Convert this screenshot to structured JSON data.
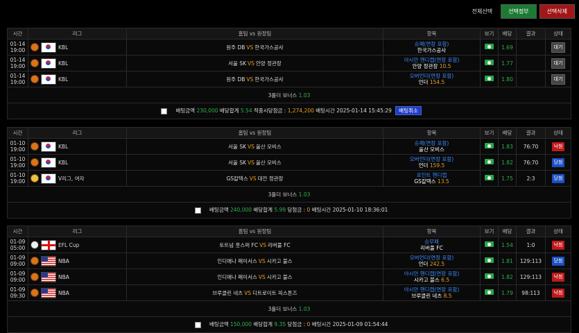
{
  "toolbar": {
    "select_all": "전체선택",
    "delete_selected_btn": "선택정부",
    "cancel_selected_btn": "선택삭제"
  },
  "headers": {
    "time": "시간",
    "league": "리그",
    "match": "홈팀 vs 원정팀",
    "item": "항목",
    "view": "보기",
    "odds": "배당",
    "result": "결과",
    "status": "상태"
  },
  "blocks": [
    {
      "rows": [
        {
          "date": "01-14",
          "time": "19:00",
          "icon": "basketball",
          "flag": "kr",
          "league": "KBL",
          "home": "원주 DB",
          "away": "한국가스공사",
          "item": "승패(연장 포함)",
          "pick": "한국가스공사",
          "pick_num": "",
          "odds": "1.69",
          "result": "",
          "status": "대기",
          "status_type": "wait"
        },
        {
          "date": "01-14",
          "time": "19:00",
          "icon": "basketball",
          "flag": "kr",
          "league": "KBL",
          "home": "서울 SK",
          "away": "안양 정관장",
          "item": "아시안 핸디캡(연장 포함)",
          "pick": "안양 정관장",
          "pick_num": "10.5",
          "odds": "1.77",
          "result": "",
          "status": "대기",
          "status_type": "wait"
        },
        {
          "date": "01-14",
          "time": "19:00",
          "icon": "basketball",
          "flag": "kr",
          "league": "KBL",
          "home": "원주 DB",
          "away": "한국가스공사",
          "item": "오버언더(연장 포함)",
          "pick": "언더",
          "pick_num": "154.5",
          "odds": "1.80",
          "result": "",
          "status": "대기",
          "status_type": "wait"
        }
      ],
      "bonus_label": "3폴더 보너스",
      "bonus_value": "1.03",
      "summary": {
        "amount_label": "배팅금액",
        "amount": "230,000",
        "total_label": "배당합계",
        "total": "5.54",
        "win_label": "적중시당첨금 :",
        "win": "1,274,200",
        "time_label": "배팅시간",
        "time": "2025-01-14 15:45:29",
        "cancel": "배팅취소"
      }
    },
    {
      "rows": [
        {
          "date": "01-10",
          "time": "19:00",
          "icon": "basketball",
          "flag": "kr",
          "league": "KBL",
          "home": "서울 SK",
          "away": "울산 모비스",
          "item": "승패(연장 포함)",
          "pick": "울산 모비스",
          "pick_num": "",
          "odds": "1.83",
          "result": "76:70",
          "status": "낙첨",
          "status_type": "lose"
        },
        {
          "date": "01-10",
          "time": "19:00",
          "icon": "basketball",
          "flag": "kr",
          "league": "KBL",
          "home": "서울 SK",
          "away": "울산 모비스",
          "item": "오버언더(연장 포함)",
          "pick": "언더",
          "pick_num": "159.5",
          "odds": "1.82",
          "result": "76:70",
          "status": "당첨",
          "status_type": "win"
        },
        {
          "date": "01-10",
          "time": "19:00",
          "icon": "volleyball",
          "flag": "kr",
          "league": "V리그, 여자",
          "home": "GS칼텍스",
          "away": "대전 정관장",
          "item": "포인트 핸디캡",
          "pick": "GS칼텍스",
          "pick_num": "13.5",
          "odds": "1.75",
          "result": "2:3",
          "status": "당첨",
          "status_type": "win"
        }
      ],
      "bonus_label": "3폴더 보너스",
      "bonus_value": "1.03",
      "summary": {
        "amount_label": "배팅금액",
        "amount": "240,000",
        "total_label": "배당합계",
        "total": "5.99",
        "win_label": "당첨금 :",
        "win": "0",
        "time_label": "배팅시간",
        "time": "2025-01-10 18:36:01",
        "cancel": ""
      }
    },
    {
      "rows": [
        {
          "date": "01-09",
          "time": "05:00",
          "icon": "soccer",
          "flag": "en",
          "league": "EFL Cup",
          "home": "토트넘 훗스퍼 FC",
          "away": "리버풀 FC",
          "item": "승무패",
          "pick": "리버풀 FC",
          "pick_num": "",
          "odds": "1.54",
          "result": "1:0",
          "status": "낙첨",
          "status_type": "lose"
        },
        {
          "date": "01-09",
          "time": "09:00",
          "icon": "basketball",
          "flag": "us",
          "league": "NBA",
          "home": "인디애나 페이서스",
          "away": "시카고 불스",
          "item": "오버언더(연장 포함)",
          "pick": "언더",
          "pick_num": "242.5",
          "odds": "1.81",
          "result": "129:113",
          "status": "당첨",
          "status_type": "win"
        },
        {
          "date": "01-09",
          "time": "09:00",
          "icon": "basketball",
          "flag": "us",
          "league": "NBA",
          "home": "인디애나 페이서스",
          "away": "시카고 불스",
          "item": "아시안 핸디캡(연장 포함)",
          "pick": "시카고 불스",
          "pick_num": "6.5",
          "odds": "1.82",
          "result": "129:113",
          "status": "낙첨",
          "status_type": "lose"
        },
        {
          "date": "01-09",
          "time": "09:30",
          "icon": "basketball",
          "flag": "us",
          "league": "NBA",
          "home": "브루클린 네츠",
          "away": "디트로이트 피스톤즈",
          "item": "아시안 핸디캡(연장 포함)",
          "pick": "브루클린 네츠",
          "pick_num": "8.5",
          "odds": "1.79",
          "result": "98:113",
          "status": "낙첨",
          "status_type": "lose"
        }
      ],
      "bonus_label": "3폴더 보너스",
      "bonus_value": "1.03",
      "summary": {
        "amount_label": "배팅금액",
        "amount": "150,000",
        "total_label": "배당합계",
        "total": "9.35",
        "win_label": "당첨금 :",
        "win": "0",
        "time_label": "배팅시간",
        "time": "2025-01-09 01:54:44",
        "cancel": ""
      }
    }
  ]
}
